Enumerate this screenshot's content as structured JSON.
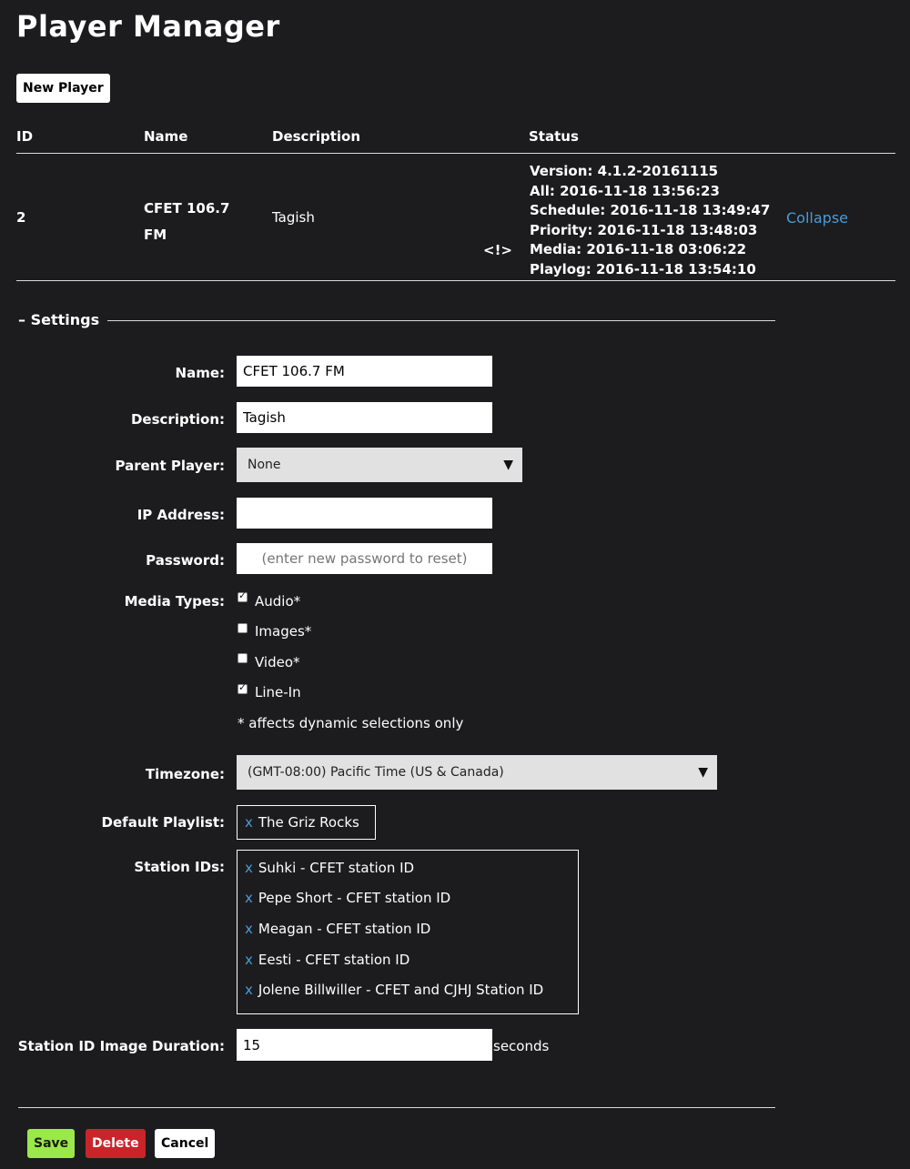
{
  "page": {
    "title": "Player Manager",
    "new_player_label": "New Player"
  },
  "table": {
    "headers": {
      "id": "ID",
      "name": "Name",
      "description": "Description",
      "status": "Status"
    },
    "row": {
      "id": "2",
      "name_line1": "CFET 106.7",
      "name_line2": "FM",
      "description": "Tagish",
      "warning": "<!>",
      "status_lines": [
        "Version: 4.1.2-20161115",
        "All: 2016-11-18 13:56:23",
        "Schedule: 2016-11-18 13:49:47",
        "Priority: 2016-11-18 13:48:03",
        "Media: 2016-11-18 03:06:22",
        "Playlog: 2016-11-18 13:54:10"
      ],
      "collapse_label": "Collapse"
    }
  },
  "settings": {
    "legend": "– Settings",
    "name_label": "Name:",
    "name_value": "CFET 106.7 FM",
    "description_label": "Description:",
    "description_value": "Tagish",
    "parent_label": "Parent Player:",
    "parent_value": "None",
    "ip_label": "IP Address:",
    "ip_value": "",
    "password_label": "Password:",
    "password_placeholder": "(enter new password to reset)",
    "media_types_label": "Media Types:",
    "media_types": [
      {
        "label": "Audio*",
        "checked": true
      },
      {
        "label": "Images*",
        "checked": false
      },
      {
        "label": "Video*",
        "checked": false
      },
      {
        "label": "Line-In",
        "checked": true
      }
    ],
    "media_note": "* affects dynamic selections only",
    "timezone_label": "Timezone:",
    "timezone_value": "(GMT-08:00) Pacific Time (US & Canada)",
    "default_playlist_label": "Default Playlist:",
    "default_playlist": {
      "x": "x",
      "name": "The Griz Rocks"
    },
    "station_ids_label": "Station IDs:",
    "station_ids": [
      {
        "x": "x",
        "name": "Suhki - CFET station ID"
      },
      {
        "x": "x",
        "name": "Pepe Short - CFET station ID"
      },
      {
        "x": "x",
        "name": "Meagan - CFET station ID"
      },
      {
        "x": "x",
        "name": "Eesti - CFET station ID"
      },
      {
        "x": "x",
        "name": "Jolene Billwiller - CFET and CJHJ Station ID"
      }
    ],
    "duration_label": "Station ID Image Duration:",
    "duration_value": "15",
    "duration_unit": "seconds"
  },
  "actions": {
    "save": "Save",
    "delete": "Delete",
    "cancel": "Cancel"
  },
  "colors": {
    "background": "#1c1c1f",
    "link": "#4a9cd6",
    "save": "#9be84a",
    "delete": "#c9242a"
  }
}
